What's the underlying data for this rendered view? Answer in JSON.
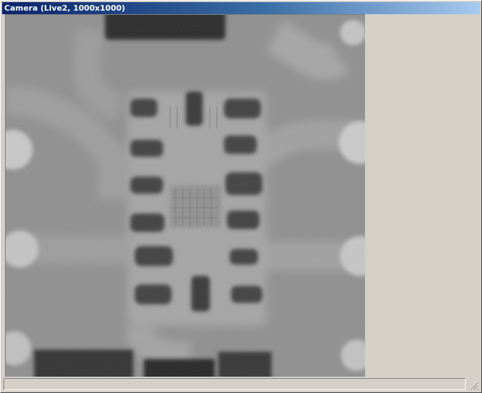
{
  "window": {
    "title": "Camera (Live2, 1000x1000)"
  },
  "status": {
    "text": ""
  },
  "colors": {
    "titlebar_start": "#0a246a",
    "titlebar_end": "#a6caf0",
    "window_bg": "#d4d0c8"
  },
  "icons": {
    "resize_grip": "resize-grip-icon"
  }
}
